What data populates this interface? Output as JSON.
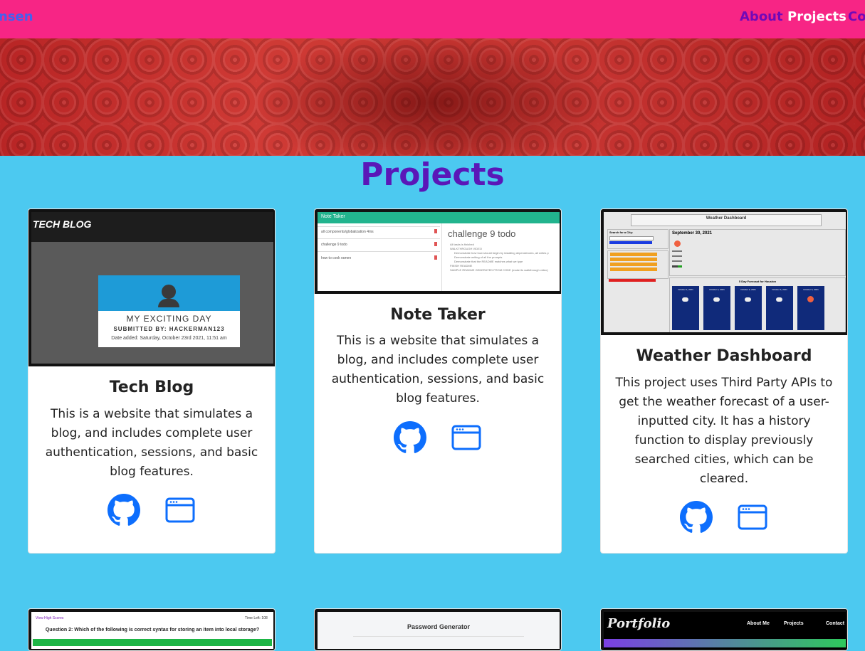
{
  "nav": {
    "brand": "nsen",
    "links": [
      {
        "label": "About",
        "color": "#7209b7"
      },
      {
        "label": "Projects",
        "color": "#ffffff"
      },
      {
        "label": "Co",
        "color": "#7209b7"
      }
    ]
  },
  "colors": {
    "navbar": "#f72585",
    "page_bg": "#4cc9f0",
    "title": "#5a17b8",
    "icon_blue": "#0d6efd"
  },
  "page_title": "Projects",
  "projects": [
    {
      "title": "Tech Blog",
      "description": "This is a website that simulates a blog, and includes complete user authentication, sessions, and basic blog features.",
      "thumb": {
        "logo": "TECH BLOG",
        "post_title": "MY EXCITING DAY",
        "submitted": "SUBMITTED BY: HACKERMAN123",
        "date": "Date added: Saturday, October 23rd 2021, 11:51 am"
      },
      "icons": [
        "github-icon",
        "browser-window-icon"
      ]
    },
    {
      "title": "Note Taker",
      "description": "This is a website that simulates a blog, and includes complete user authentication, sessions, and basic blog features.",
      "thumb": {
        "app_name": "Note Taker",
        "notes": [
          "all components/globalization 4ms",
          "challenge 9 todo",
          "how to cook ramen"
        ],
        "heading": "challenge 9 todo",
        "lines": [
          "All tasks is finished",
          "WALKTHROUGH VIDEO",
          "Demonstrate how how should begin by installing dependencies, all writes p",
          "Demonstrate writing of all the prompts",
          "Demonstrate that the README matches what we type",
          "FINISH README",
          "SAMPLE README GENERATED FROM CODE (make its walkthrough video)"
        ]
      },
      "icons": [
        "github-icon",
        "browser-window-icon"
      ]
    },
    {
      "title": "Weather Dashboard",
      "description": "This project uses Third Party APIs to get the weather forecast of a user-inputted city. It has a history function to display previously searched cities, which can be cleared.",
      "thumb": {
        "header": "Weather Dashboard",
        "search_label": "Search for a City:",
        "current_date": "September 30, 2021",
        "forecast_title": "5 Day Forecast for Houston",
        "days": [
          "October 1, 2021",
          "October 2, 2021",
          "October 3, 2021",
          "October 4, 2021",
          "October 5, 2021"
        ]
      },
      "icons": [
        "github-icon",
        "browser-window-icon"
      ]
    }
  ],
  "row2": [
    {
      "caption": "Question 2: Which of the following is correct syntax for storing an item into local storage?",
      "left": "View High Scores",
      "right": "Time Left: 108"
    },
    {
      "caption": "Password Generator"
    },
    {
      "logo": "Portfolio",
      "links": [
        "About Me",
        "Projects",
        "Contact"
      ]
    }
  ]
}
